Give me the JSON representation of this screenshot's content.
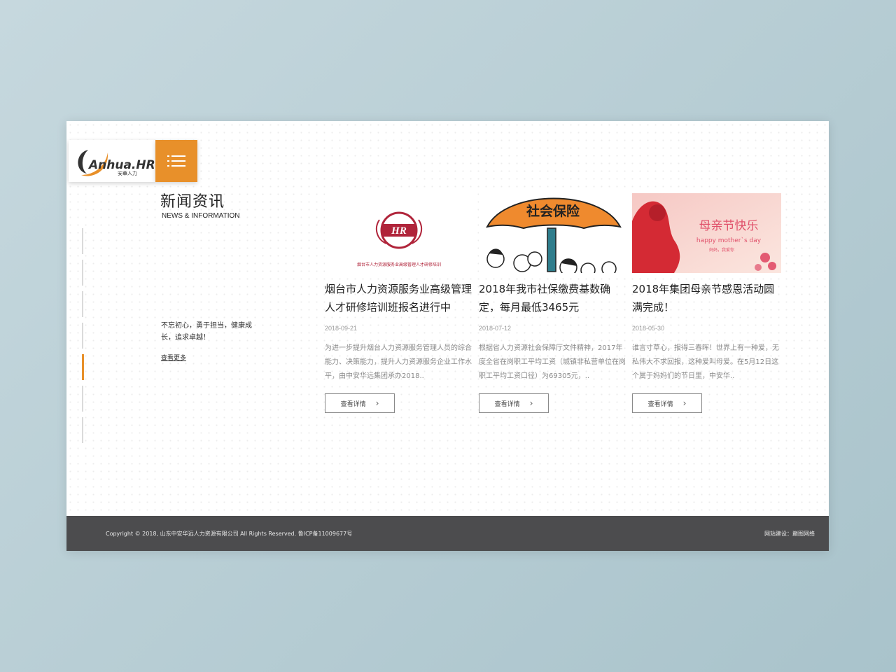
{
  "brand": {
    "logo_text": "Anhua.HR",
    "logo_sub": "安華人力",
    "accent": "#e8902a"
  },
  "nav": {
    "menu_icon": "hamburger-icon",
    "rail_active_index": 4
  },
  "section": {
    "title": "新闻资讯",
    "subtitle": "NEWS & INFORMATION",
    "motto": "不忘初心，勇于担当，健康成长，追求卓越！",
    "more_label": "查看更多"
  },
  "news": [
    {
      "thumb_caption": "烟台市人力资源服务业高级管理人才研修培训",
      "title": "烟台市人力资源服务业高级管理人才研修培训班报名进行中",
      "date": "2018-09-21",
      "desc": "为进一步提升烟台人力资源服务管理人员的综合能力、决策能力，提升人力资源服务企业工作水平，由中安华远集团承办2018..",
      "button": "查看详情"
    },
    {
      "thumb_caption": "社会保险",
      "title": "2018年我市社保缴费基数确定，每月最低3465元",
      "date": "2018-07-12",
      "desc": "根据省人力资源社会保障厅文件精神，2017年度全省在岗职工平均工资（城镇非私营单位在岗职工平均工资口径）为69305元，..",
      "button": "查看详情"
    },
    {
      "thumb_caption": "母亲节快乐",
      "thumb_caption_en": "happy mother`s day",
      "thumb_caption_small": "妈妈，我爱你",
      "title": "2018年集团母亲节感恩活动圆满完成！",
      "date": "2018-05-30",
      "desc": "谁言寸草心，报得三春晖！世界上有一种爱，无私伟大不求回报，这种爱叫母爱。在5月12日这个属于妈妈们的节日里，中安华..",
      "button": "查看详情"
    }
  ],
  "footer": {
    "copyright": "Copyright © 2018, 山东中安华远人力资源有限公司 All Rights Reserved. 鲁ICP备11009677号",
    "builder": "网站建设：巅图网络"
  }
}
